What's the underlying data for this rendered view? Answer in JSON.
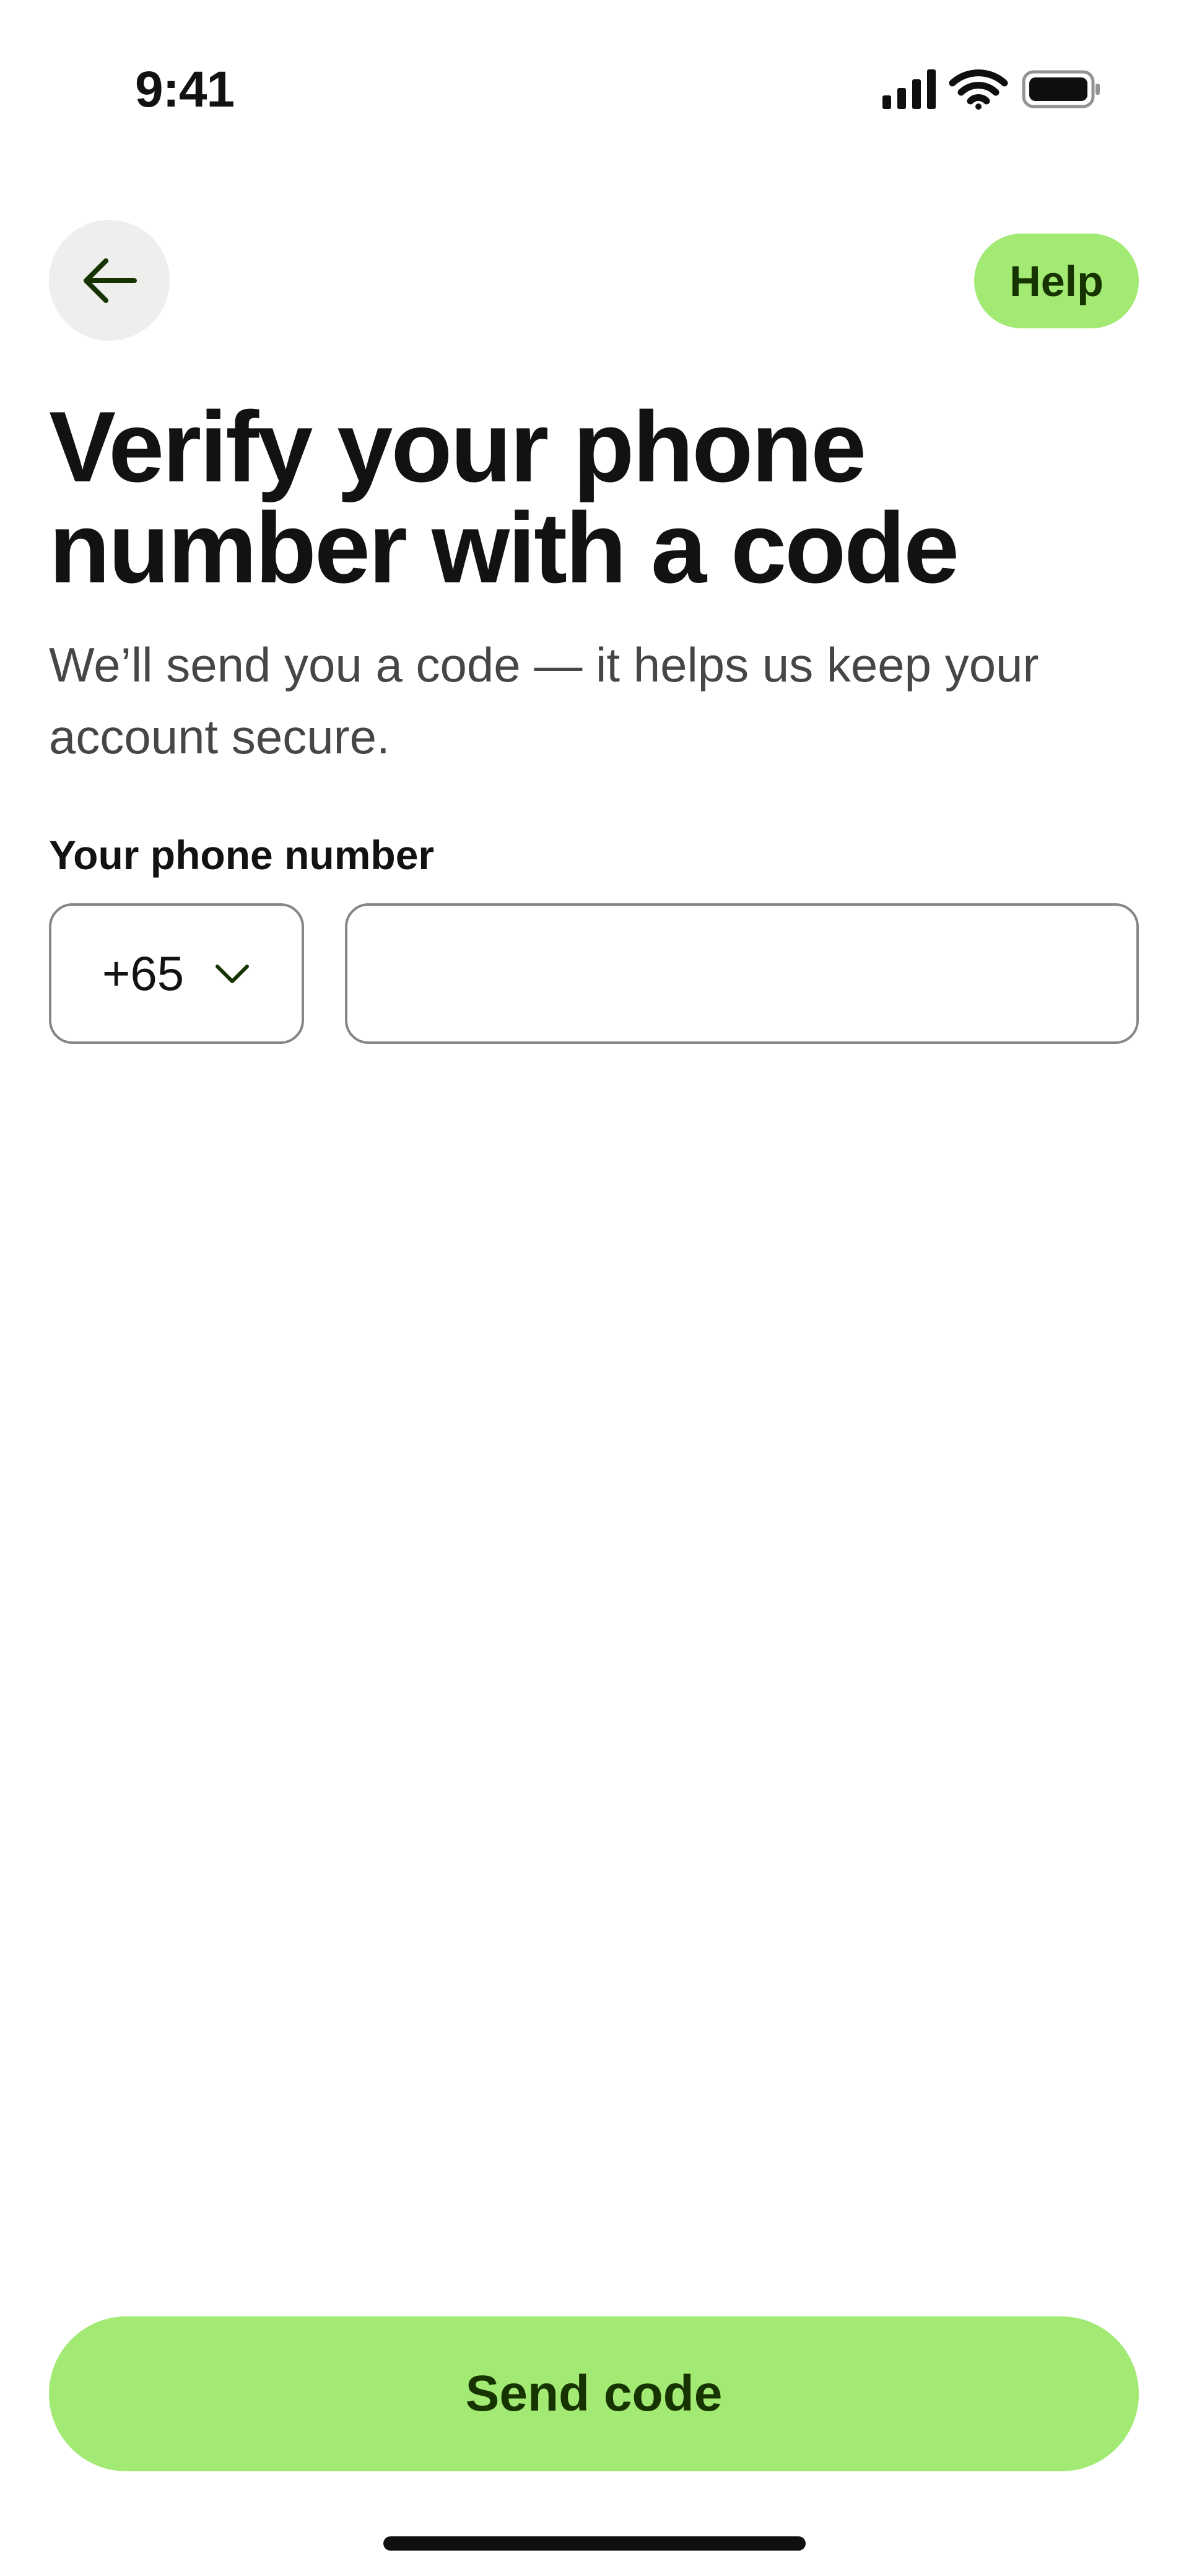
{
  "status_bar": {
    "time": "9:41",
    "icons": [
      "signal-icon",
      "wifi-icon",
      "battery-icon"
    ]
  },
  "header": {
    "back_icon": "arrow-left-icon",
    "help_label": "Help"
  },
  "content": {
    "title": "Verify your phone number with a code",
    "subtitle": "We’ll send you a code — it helps us keep your account secure."
  },
  "phone_field": {
    "label": "Your phone number",
    "country_code": "+65",
    "dropdown_icon": "chevron-down-icon",
    "number_value": "",
    "number_placeholder": ""
  },
  "cta": {
    "send_label": "Send code"
  },
  "colors": {
    "accent": "#a2ea74",
    "accent_text": "#163300",
    "text_primary": "#121212",
    "text_secondary": "#454745",
    "border": "#868685",
    "back_button_bg": "#eeeeec"
  }
}
